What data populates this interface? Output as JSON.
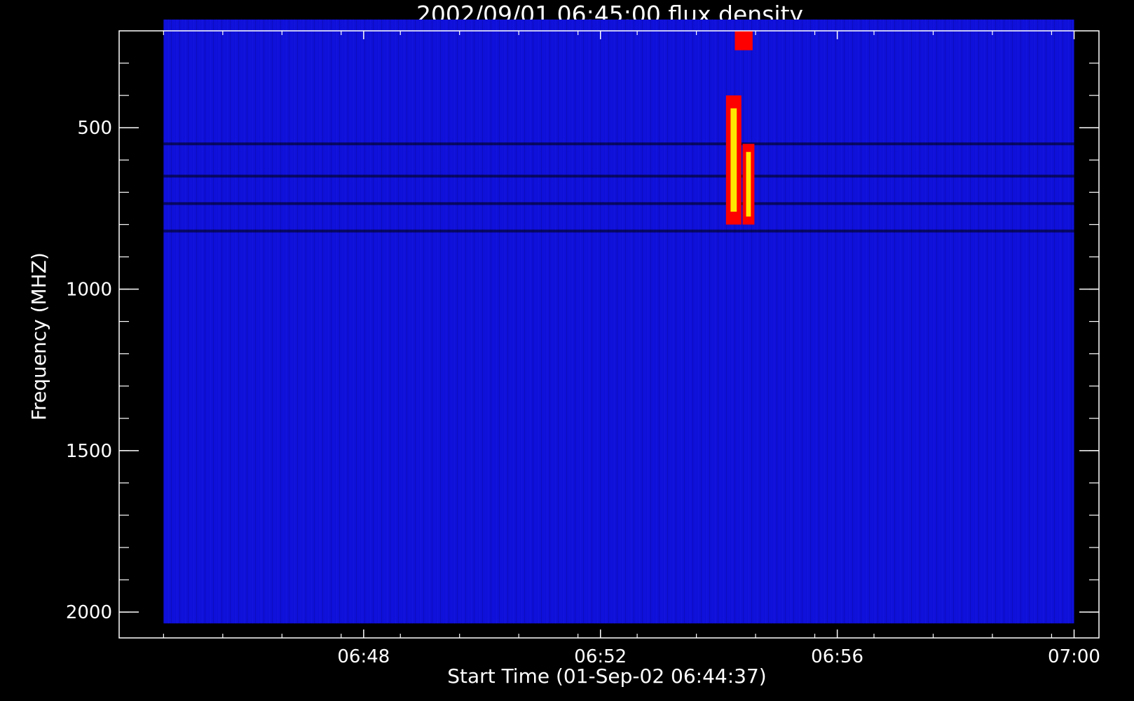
{
  "chart_data": {
    "type": "heatmap",
    "title": "2002/09/01 06:45:00 flux density",
    "xlabel": "Start Time (01-Sep-02 06:44:37)",
    "ylabel": "Frequency (MHZ)",
    "x_ticks": [
      {
        "value": 3.38,
        "label": "06:48"
      },
      {
        "value": 7.38,
        "label": "06:52"
      },
      {
        "value": 11.38,
        "label": "06:56"
      },
      {
        "value": 15.38,
        "label": "07:00"
      }
    ],
    "y_ticks": [
      {
        "value": 500,
        "label": "500"
      },
      {
        "value": 1000,
        "label": "1000"
      },
      {
        "value": 1500,
        "label": "1500"
      },
      {
        "value": 2000,
        "label": "2000"
      }
    ],
    "xlim": [
      -0.75,
      15.8
    ],
    "ylim": [
      2080,
      200
    ],
    "data_extent": {
      "x": [
        0.0,
        15.38
      ],
      "y": [
        165,
        2035
      ]
    },
    "y_scale": "linear",
    "inverted_y": true,
    "grid": false,
    "background_color": "#0f10d8",
    "colors": {
      "low": "#000000",
      "base": "#0f10d8",
      "mid": "#ff0000",
      "high": "#ffff00"
    },
    "horizontal_lines_mhz": [
      550,
      650,
      735,
      820
    ],
    "bursts": [
      {
        "t_start": 9.5,
        "t_end": 9.76,
        "f_low": 400,
        "f_high": 800,
        "peak": "high"
      },
      {
        "t_start": 9.78,
        "t_end": 9.98,
        "f_low": 550,
        "f_high": 800,
        "peak": "high"
      },
      {
        "t_start": 9.65,
        "t_end": 9.95,
        "f_low": 200,
        "f_high": 260,
        "peak": "mid"
      }
    ]
  }
}
